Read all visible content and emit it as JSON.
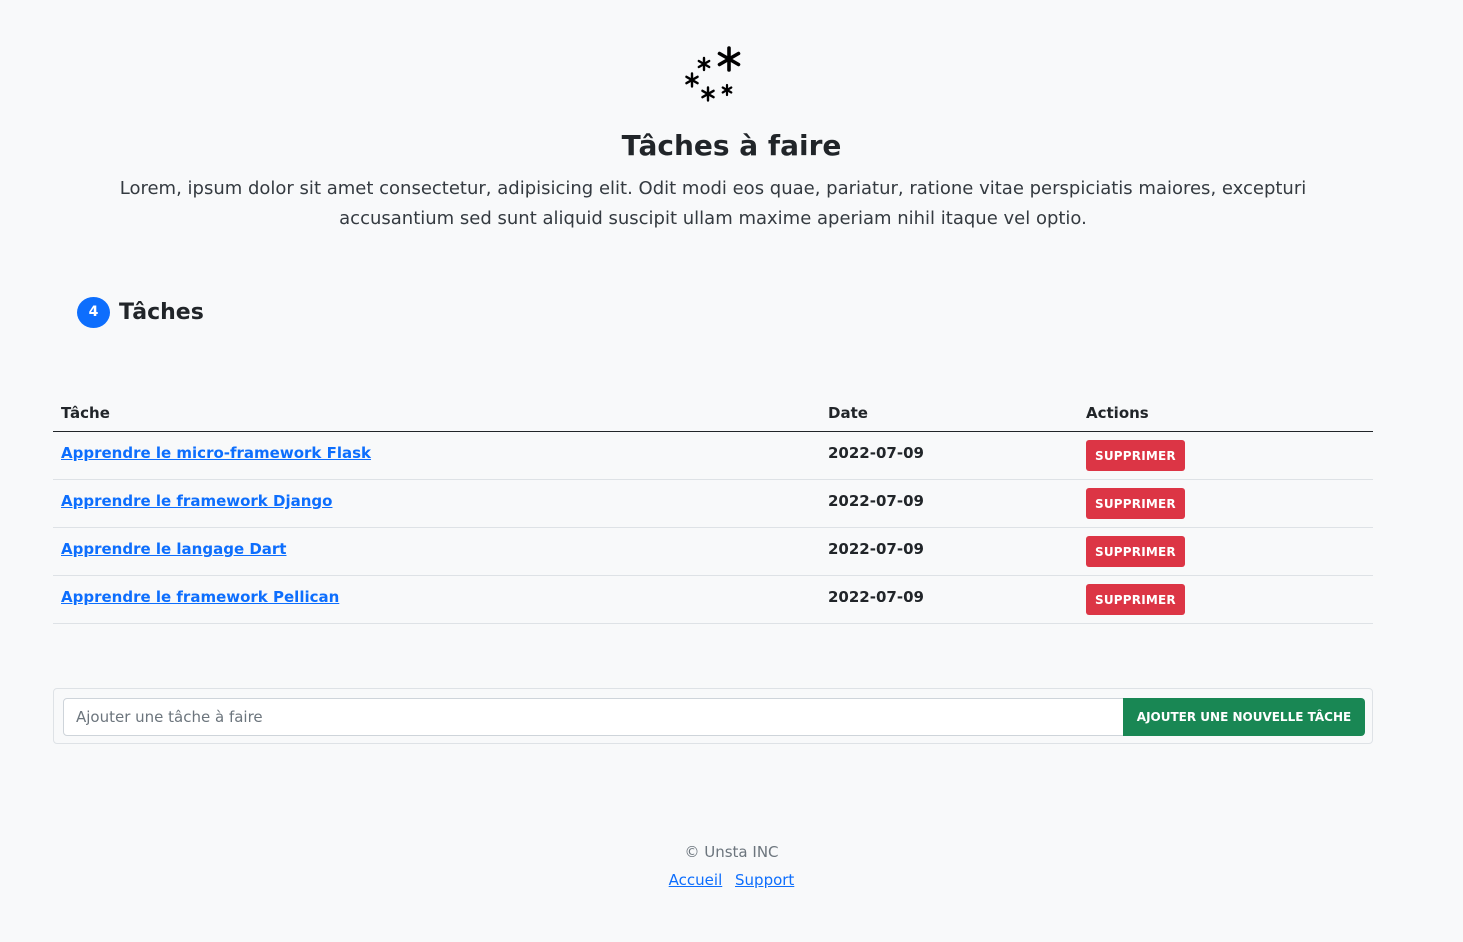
{
  "header": {
    "logo_icon": "asterisk-cluster-icon",
    "title": "Tâches à faire",
    "lead": "Lorem, ipsum dolor sit amet consectetur, adipisicing elit. Odit modi eos quae, pariatur, ratione vitae perspiciatis maiores, excepturi accusantium sed sunt aliquid suscipit ullam maxime aperiam nihil itaque vel optio."
  },
  "tasks_section": {
    "count": "4",
    "title": "Tâches",
    "badge_color": "#0d6efd"
  },
  "table": {
    "headers": {
      "task": "Tâche",
      "date": "Date",
      "actions": "Actions"
    },
    "rows": [
      {
        "task": "Apprendre le micro-framework Flask",
        "date": "2022-07-09",
        "action": "Supprimer"
      },
      {
        "task": "Apprendre le framework Django",
        "date": "2022-07-09",
        "action": "Supprimer"
      },
      {
        "task": "Apprendre le langage Dart",
        "date": "2022-07-09",
        "action": "Supprimer"
      },
      {
        "task": "Apprendre le framework Pellican",
        "date": "2022-07-09",
        "action": "Supprimer"
      }
    ],
    "delete_color": "#dc3545"
  },
  "add_form": {
    "input_value": "",
    "placeholder": "Ajouter une tâche à faire",
    "button_label": "Ajouter une nouvelle tâche",
    "button_color": "#198754"
  },
  "footer": {
    "copyright": "© Unsta INC",
    "links": [
      "Accueil",
      "Support"
    ]
  }
}
